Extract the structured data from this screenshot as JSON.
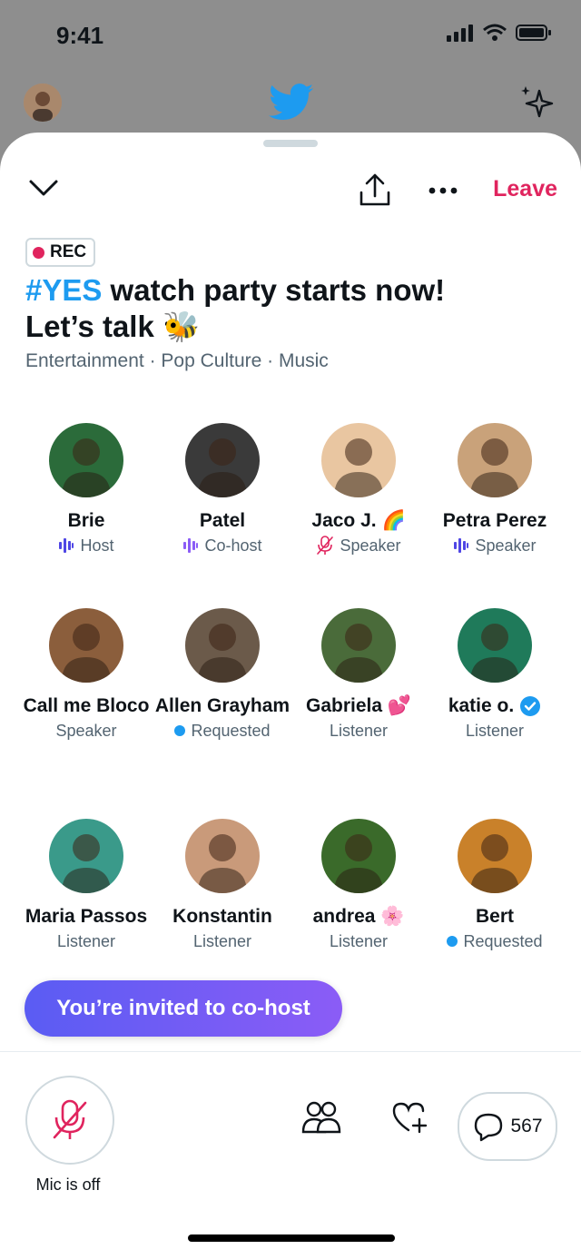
{
  "status": {
    "time": "9:41"
  },
  "header": {
    "leave_label": "Leave"
  },
  "space": {
    "rec_label": "REC",
    "title_hashtag": "#YES",
    "title_rest": " watch party starts now!",
    "title_line2": "Let’s talk 🐝",
    "topics": "Entertainment · Pop Culture · Music"
  },
  "people": [
    {
      "name": "Brie",
      "role": "Host",
      "role_icon": "speaking-wave-icon",
      "avatar_color": "#2b6b3a"
    },
    {
      "name": "Patel",
      "role": "Co-host",
      "role_icon": "speaking-wave-icon",
      "avatar_color": "#3a3a3a"
    },
    {
      "name": "Jaco J. 🌈",
      "role": "Speaker",
      "role_icon": "mic-off-icon",
      "avatar_color": "#e9c6a1"
    },
    {
      "name": "Petra Perez",
      "role": "Speaker",
      "role_icon": "speaking-wave-icon",
      "avatar_color": "#c9a27a"
    },
    {
      "name": "Call me Bloco",
      "role": "Speaker",
      "role_icon": "",
      "avatar_color": "#8b5e3c"
    },
    {
      "name": "Allen Grayham",
      "role": "Requested",
      "role_icon": "requested-dot",
      "avatar_color": "#6b5a4a"
    },
    {
      "name": "Gabriela 💕",
      "role": "Listener",
      "role_icon": "",
      "avatar_color": "#4a6b3a"
    },
    {
      "name": "katie o.",
      "role": "Listener",
      "role_icon": "",
      "avatar_color": "#1f7a5a"
    },
    {
      "name": "Maria Passos",
      "role": "Listener",
      "role_icon": "",
      "avatar_color": "#3a9a8a"
    },
    {
      "name": "Konstantin",
      "role": "Listener",
      "role_icon": "",
      "avatar_color": "#c99a7a"
    },
    {
      "name": "andrea 🌸",
      "role": "Listener",
      "role_icon": "",
      "avatar_color": "#3a6a2a"
    },
    {
      "name": "Bert",
      "role": "Requested",
      "role_icon": "requested-dot",
      "avatar_color": "#c9812a"
    }
  ],
  "invite": {
    "label": "You’re invited to co-host"
  },
  "bottom": {
    "mic_label": "Mic is off",
    "replies_count": "567"
  }
}
